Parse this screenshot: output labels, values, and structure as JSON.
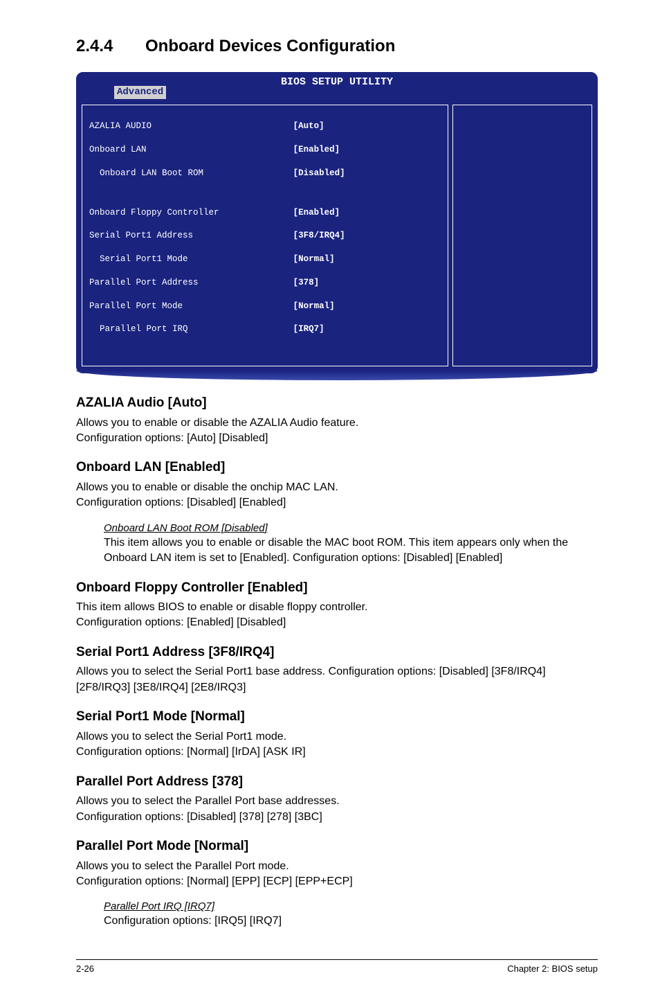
{
  "section": {
    "number": "2.4.4",
    "title": "Onboard Devices Configuration"
  },
  "bios": {
    "titlebar": "BIOS SETUP UTILITY",
    "tab": "Advanced",
    "rows_top": [
      {
        "label": "AZALIA AUDIO",
        "value": "[Auto]"
      },
      {
        "label": "Onboard LAN",
        "value": "[Enabled]"
      },
      {
        "label": "  Onboard LAN Boot ROM",
        "value": "[Disabled]"
      }
    ],
    "rows_bottom": [
      {
        "label": "Onboard Floppy Controller",
        "value": "[Enabled]"
      },
      {
        "label": "Serial Port1 Address",
        "value": "[3F8/IRQ4]"
      },
      {
        "label": "  Serial Port1 Mode",
        "value": "[Normal]"
      },
      {
        "label": "Parallel Port Address",
        "value": "[378]"
      },
      {
        "label": "Parallel Port Mode",
        "value": "[Normal]"
      },
      {
        "label": "  Parallel Port IRQ",
        "value": "[IRQ7]"
      }
    ]
  },
  "sections": {
    "azalia": {
      "heading": "AZALIA Audio [Auto]",
      "p1": "Allows you to enable or disable the AZALIA Audio feature.",
      "p2": "Configuration options: [Auto] [Disabled]"
    },
    "lan": {
      "heading": "Onboard LAN [Enabled]",
      "p1": "Allows you to enable or disable the onchip MAC LAN.",
      "p2": "Configuration options: [Disabled] [Enabled]",
      "sub_title": "Onboard LAN Boot ROM [Disabled]",
      "sub_body": "This item allows you to enable or disable the MAC boot ROM. This item appears only when the Onboard LAN item is set to [Enabled]. Configuration options: [Disabled] [Enabled]"
    },
    "floppy": {
      "heading": "Onboard Floppy Controller [Enabled]",
      "p1": "This item allows BIOS to enable or disable floppy controller.",
      "p2": "Configuration options: [Enabled] [Disabled]"
    },
    "serial_addr": {
      "heading": "Serial Port1 Address [3F8/IRQ4]",
      "p1": "Allows you to select the Serial Port1 base address. Configuration options: [Disabled] [3F8/IRQ4][2F8/IRQ3] [3E8/IRQ4] [2E8/IRQ3]"
    },
    "serial_mode": {
      "heading": "Serial Port1 Mode [Normal]",
      "p1": "Allows you to select the Serial Port1  mode.",
      "p2": "Configuration options: [Normal] [IrDA] [ASK IR]"
    },
    "par_addr": {
      "heading": "Parallel Port Address [378]",
      "p1": "Allows you to select the Parallel Port base addresses.",
      "p2": "Configuration options: [Disabled] [378] [278] [3BC]"
    },
    "par_mode": {
      "heading": "Parallel Port Mode [Normal]",
      "p1": "Allows you to select the Parallel Port  mode.",
      "p2": "Configuration options: [Normal] [EPP] [ECP] [EPP+ECP]",
      "sub_title": "Parallel Port IRQ [IRQ7]",
      "sub_body": "Configuration options: [IRQ5] [IRQ7]"
    }
  },
  "footer": {
    "left": "2-26",
    "right": "Chapter 2: BIOS setup"
  }
}
